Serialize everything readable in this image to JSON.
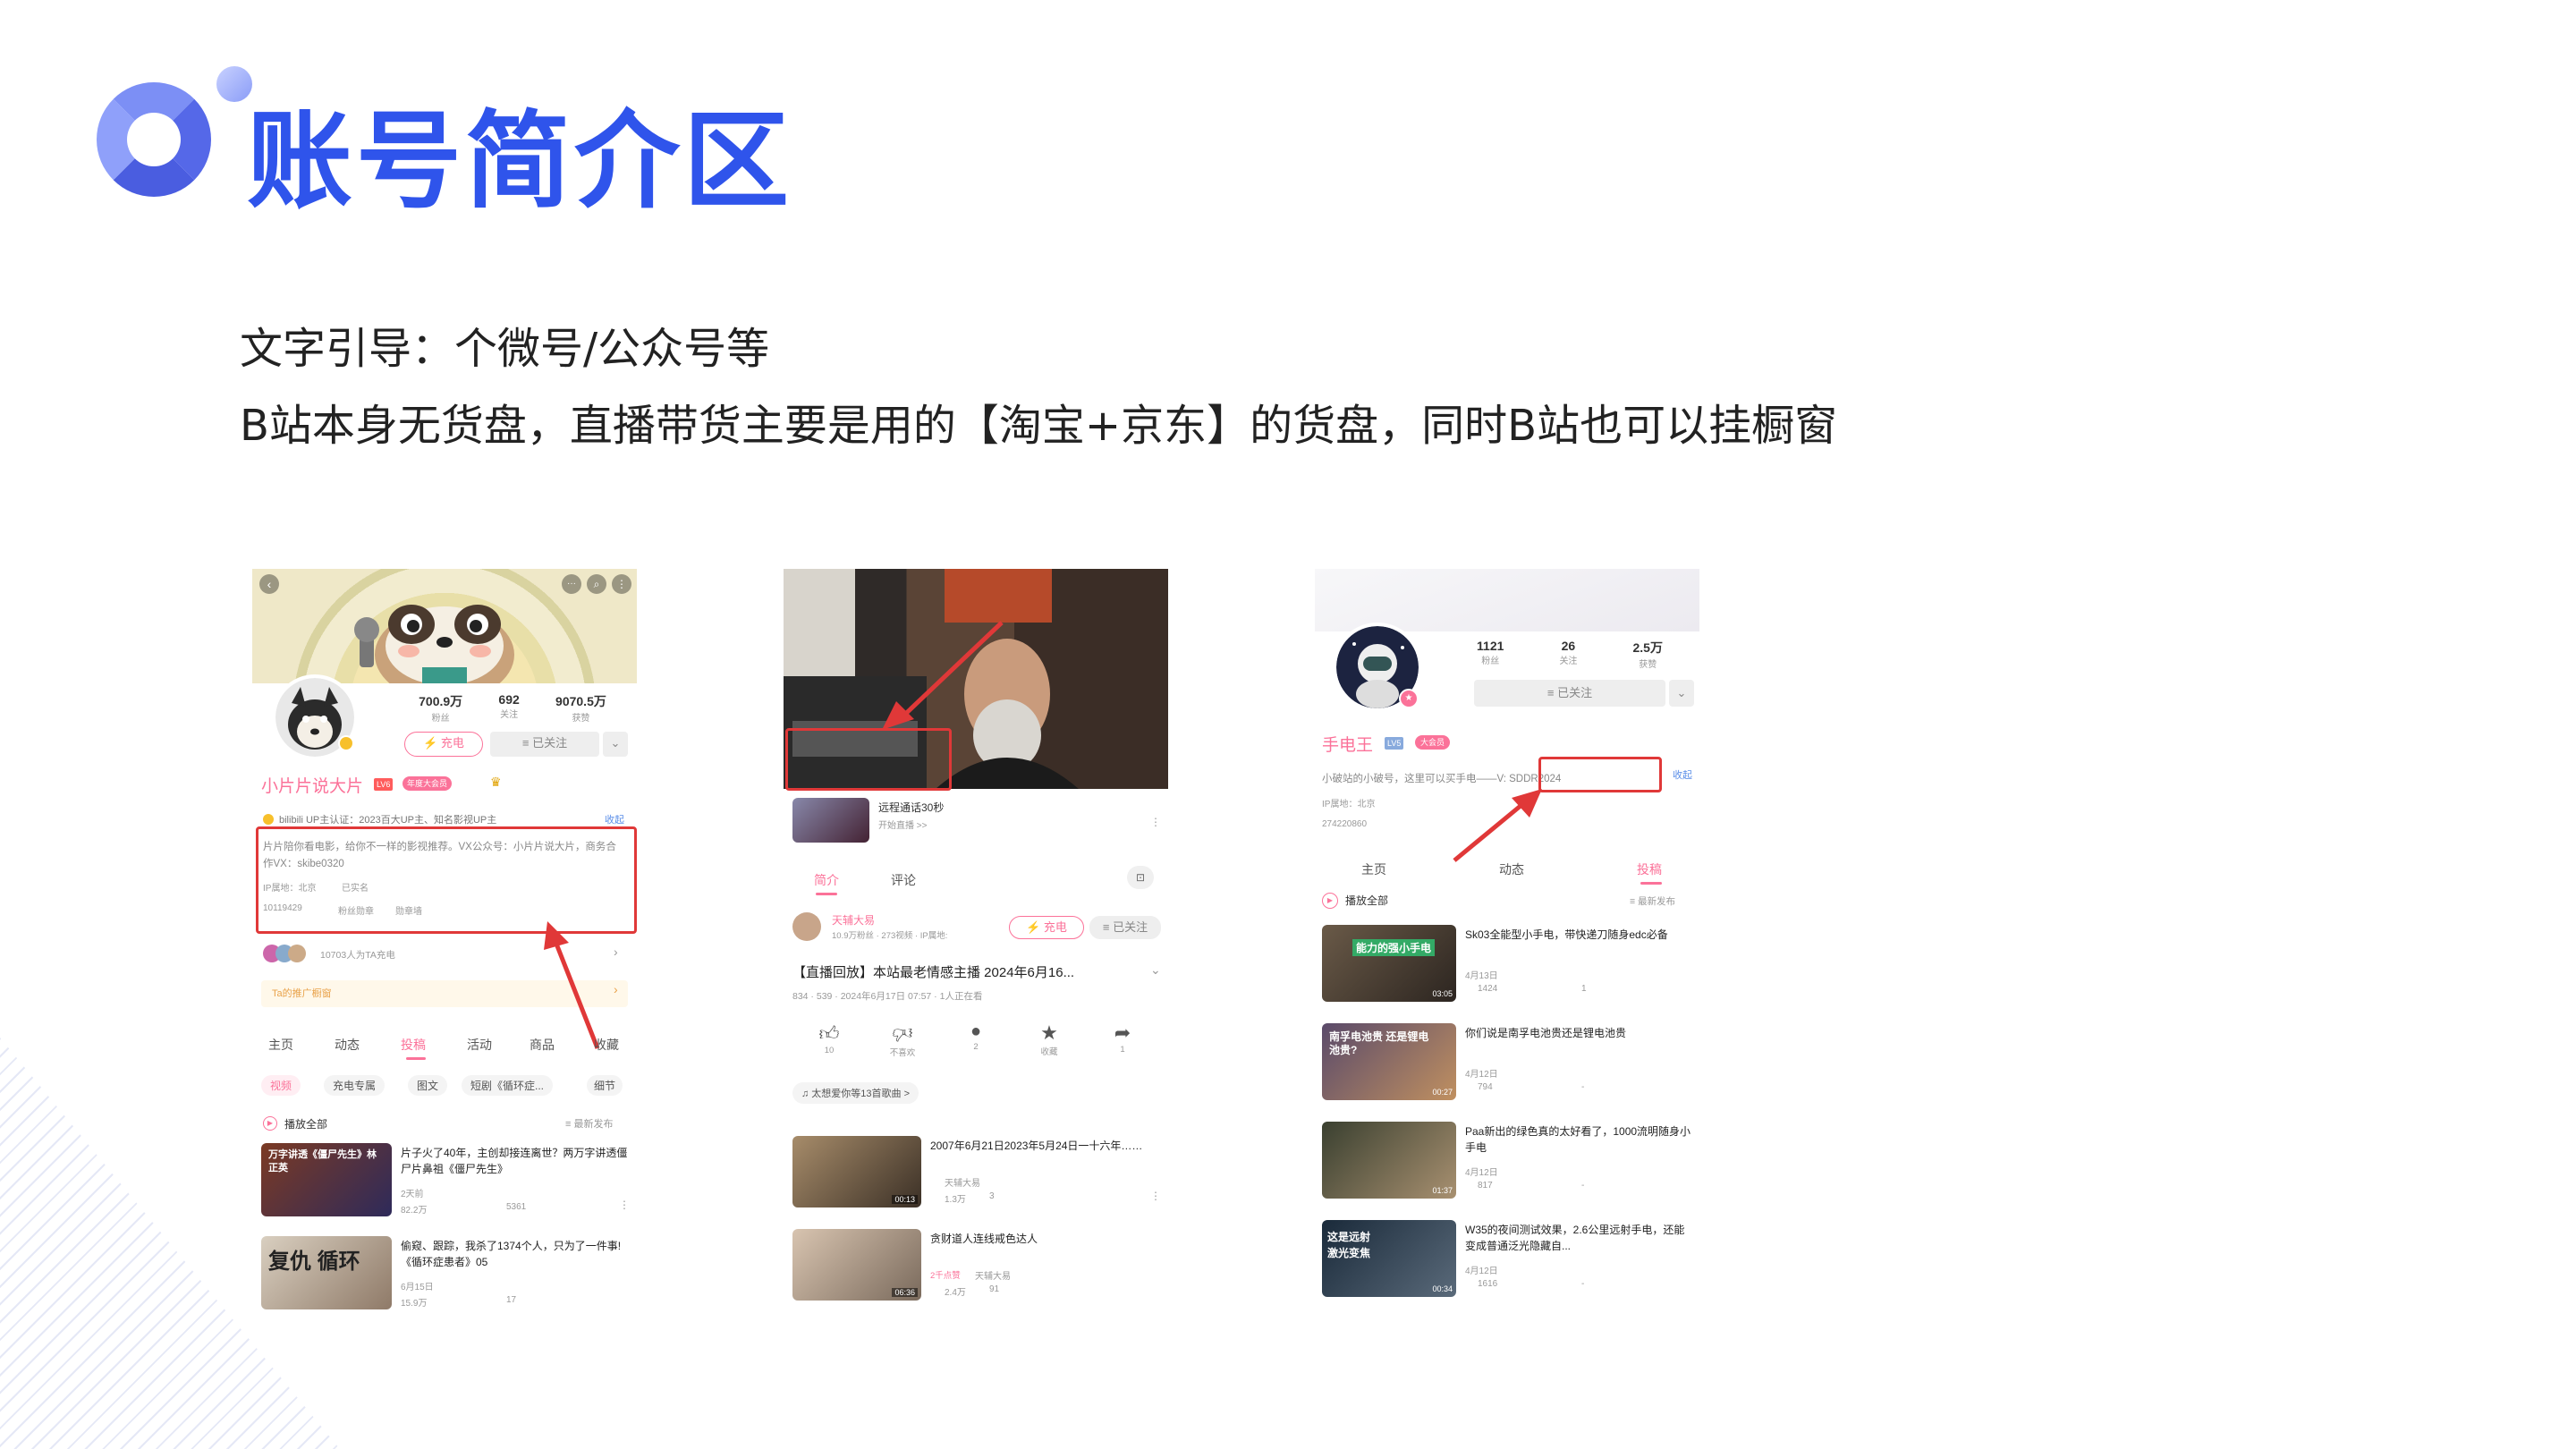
{
  "slide": {
    "title": "账号简介区",
    "line1": "文字引导：个微号/公众号等",
    "line2": "B站本身无货盘，直播带货主要是用的【淘宝+京东】的货盘，同时B站也可以挂橱窗",
    "accent_color": "#2f54eb"
  },
  "phone1": {
    "stats": [
      {
        "value": "700.9万",
        "label": "粉丝"
      },
      {
        "value": "692",
        "label": "关注"
      },
      {
        "value": "9070.5万",
        "label": "获赞"
      }
    ],
    "charge_label": "⚡ 充电",
    "follow_label": "≡ 已关注",
    "name": "小片片说大片",
    "level": "LV6",
    "vip": "年度大会员",
    "cert": "bilibili UP主认证：2023百大UP主、知名影视UP主",
    "collapse": "收起",
    "bio": "片片陪你看电影，给你不一样的影视推荐。VX公众号：小片片说大片，商务合作VX：skibe0320",
    "ip": "IP属地：北京",
    "realname": "已实名",
    "uid": "10119429",
    "fans_badge": "粉丝勋章",
    "nameplate": "勋章墙",
    "charge_count": "10703人为TA充电",
    "shop": "Ta的推广橱窗",
    "tabs": [
      "主页",
      "动态",
      "投稿",
      "活动",
      "商品",
      "收藏"
    ],
    "subtabs": [
      "视频",
      "充电专属",
      "图文",
      "短剧《循环症...",
      "细节"
    ],
    "play_all": "播放全部",
    "sort": "≡ 最新发布",
    "videos": [
      {
        "title": "片子火了40年，主创却接连离世？两万字讲透僵尸片鼻祖《僵尸先生》",
        "date": "2天前",
        "views": "82.2万",
        "danmaku": "5361",
        "thumb": "万字讲透《僵尸先生》林正英"
      },
      {
        "title": "偷窥、跟踪，我杀了1374个人，只为了一件事!《循环症患者》05",
        "date": "6月15日",
        "views": "15.9万",
        "danmaku": "17",
        "thumb": "复仇 循环"
      }
    ]
  },
  "phone2": {
    "live_title": "远程通话30秒",
    "live_sub": "开始直播 >>",
    "tabs": [
      "简介",
      "评论"
    ],
    "author": "天辅大易",
    "author_sub": "10.9万粉丝 · 273视频 · IP属地:",
    "charge_label": "⚡ 充电",
    "follow_label": "≡ 已关注",
    "video_title": "【直播回放】本站最老情感主播 2024年6月16...",
    "meta": "834 · 539 · 2024年6月17日 07:57 · 1人正在看",
    "actions": [
      {
        "icon": "like-icon",
        "label": "10"
      },
      {
        "icon": "dislike-icon",
        "label": "不喜欢"
      },
      {
        "icon": "coin-icon",
        "label": "2"
      },
      {
        "icon": "star-icon",
        "label": "收藏"
      },
      {
        "icon": "share-icon",
        "label": "1"
      }
    ],
    "music": "♫ 太想爱你等13首歌曲 >",
    "videos": [
      {
        "title": "2007年6月21日2023年5月24日一十六年……",
        "author": "天辅大易",
        "views": "1.3万",
        "danmaku": "3",
        "duration": "00:13"
      },
      {
        "title": "贪财道人连线戒色达人",
        "author": "天辅大易",
        "views": "2.4万",
        "danmaku": "91",
        "duration": "06:36",
        "badge": "2千点赞"
      }
    ]
  },
  "phone3": {
    "stats": [
      {
        "value": "1121",
        "label": "粉丝"
      },
      {
        "value": "26",
        "label": "关注"
      },
      {
        "value": "2.5万",
        "label": "获赞"
      }
    ],
    "follow_label": "≡ 已关注",
    "name": "手电王",
    "level": "LV5",
    "vip": "大会员",
    "bio": "小破站的小破号，这里可以买手电——V: SDDR2024",
    "collapse": "收起",
    "ip": "IP属地：北京",
    "uid": "274220860",
    "tabs": [
      "主页",
      "动态",
      "投稿"
    ],
    "play_all": "播放全部",
    "sort": "≡ 最新发布",
    "videos": [
      {
        "title": "Sk03全能型小手电，带快递刀随身edc必备",
        "date": "4月13日",
        "views": "1424",
        "danmaku": "1",
        "duration": "03:05",
        "thumb": "能力的强小手电"
      },
      {
        "title": "你们说是南孚电池贵还是锂电池贵",
        "date": "4月12日",
        "views": "794",
        "danmaku": "-",
        "duration": "00:27",
        "thumb": "南孚电池贵 还是锂电池贵?"
      },
      {
        "title": "Paa新出的绿色真的太好看了，1000流明随身小手电",
        "date": "4月12日",
        "views": "817",
        "danmaku": "-",
        "duration": "01:37",
        "thumb": ""
      },
      {
        "title": "W35的夜间测试效果，2.6公里远射手电，还能变成普通泛光隐藏自...",
        "date": "4月12日",
        "views": "1616",
        "danmaku": "-",
        "duration": "00:34",
        "thumb": "这是远射 激光变焦"
      }
    ]
  }
}
